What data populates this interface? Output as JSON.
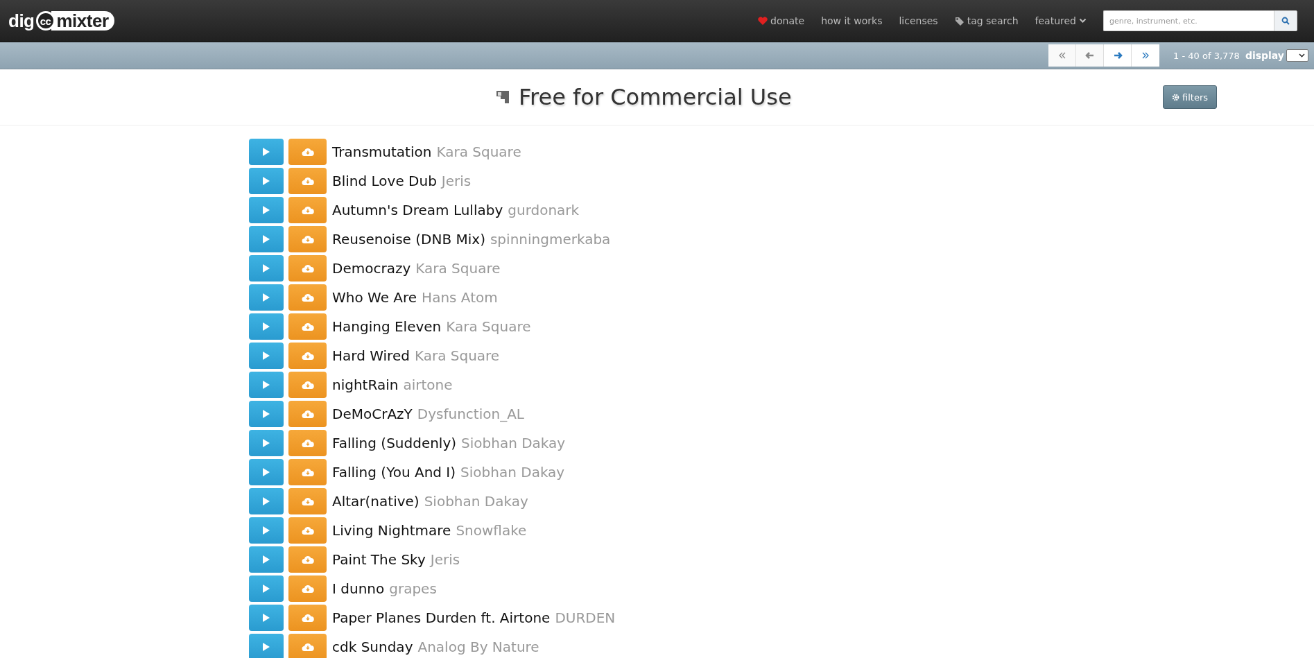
{
  "logo": {
    "left": "dig",
    "badge": "cc",
    "right": "mixter"
  },
  "nav": [
    {
      "label": "donate",
      "kind": "heart"
    },
    {
      "label": "how it works",
      "kind": "plain"
    },
    {
      "label": "licenses",
      "kind": "plain"
    },
    {
      "label": "tag search",
      "kind": "tag"
    },
    {
      "label": "featured",
      "kind": "dropdown"
    }
  ],
  "search": {
    "placeholder": "genre, instrument, etc."
  },
  "pager": {
    "buttons": [
      {
        "kind": "first",
        "disabled": true
      },
      {
        "kind": "prev",
        "disabled": true
      },
      {
        "kind": "next",
        "disabled": false
      },
      {
        "kind": "last",
        "disabled": false
      }
    ],
    "range": "1 - 40 of 3,778",
    "display_label": "display"
  },
  "page_title": "Free for Commercial Use",
  "filters_button": "filters",
  "tracks": [
    {
      "title": "Transmutation",
      "artist": "Kara Square"
    },
    {
      "title": "Blind Love Dub",
      "artist": "Jeris"
    },
    {
      "title": "Autumn's Dream Lullaby",
      "artist": "gurdonark"
    },
    {
      "title": "Reusenoise (DNB Mix)",
      "artist": "spinningmerkaba"
    },
    {
      "title": "Democrazy",
      "artist": "Kara Square"
    },
    {
      "title": "Who We Are",
      "artist": "Hans Atom"
    },
    {
      "title": "Hanging Eleven",
      "artist": "Kara Square"
    },
    {
      "title": "Hard Wired",
      "artist": "Kara Square"
    },
    {
      "title": "nightRain",
      "artist": "airtone"
    },
    {
      "title": "DeMoCrAzY",
      "artist": "Dysfunction_AL"
    },
    {
      "title": "Falling (Suddenly)",
      "artist": "Siobhan Dakay"
    },
    {
      "title": "Falling (You And I)",
      "artist": "Siobhan Dakay"
    },
    {
      "title": "Altar(native)",
      "artist": "Siobhan Dakay"
    },
    {
      "title": "Living Nightmare",
      "artist": "Snowflake"
    },
    {
      "title": "Paint The Sky",
      "artist": "Jeris"
    },
    {
      "title": "I dunno",
      "artist": "grapes"
    },
    {
      "title": "Paper Planes Durden ft. Airtone",
      "artist": "DURDEN"
    },
    {
      "title": "cdk Sunday",
      "artist": "Analog By Nature"
    }
  ]
}
